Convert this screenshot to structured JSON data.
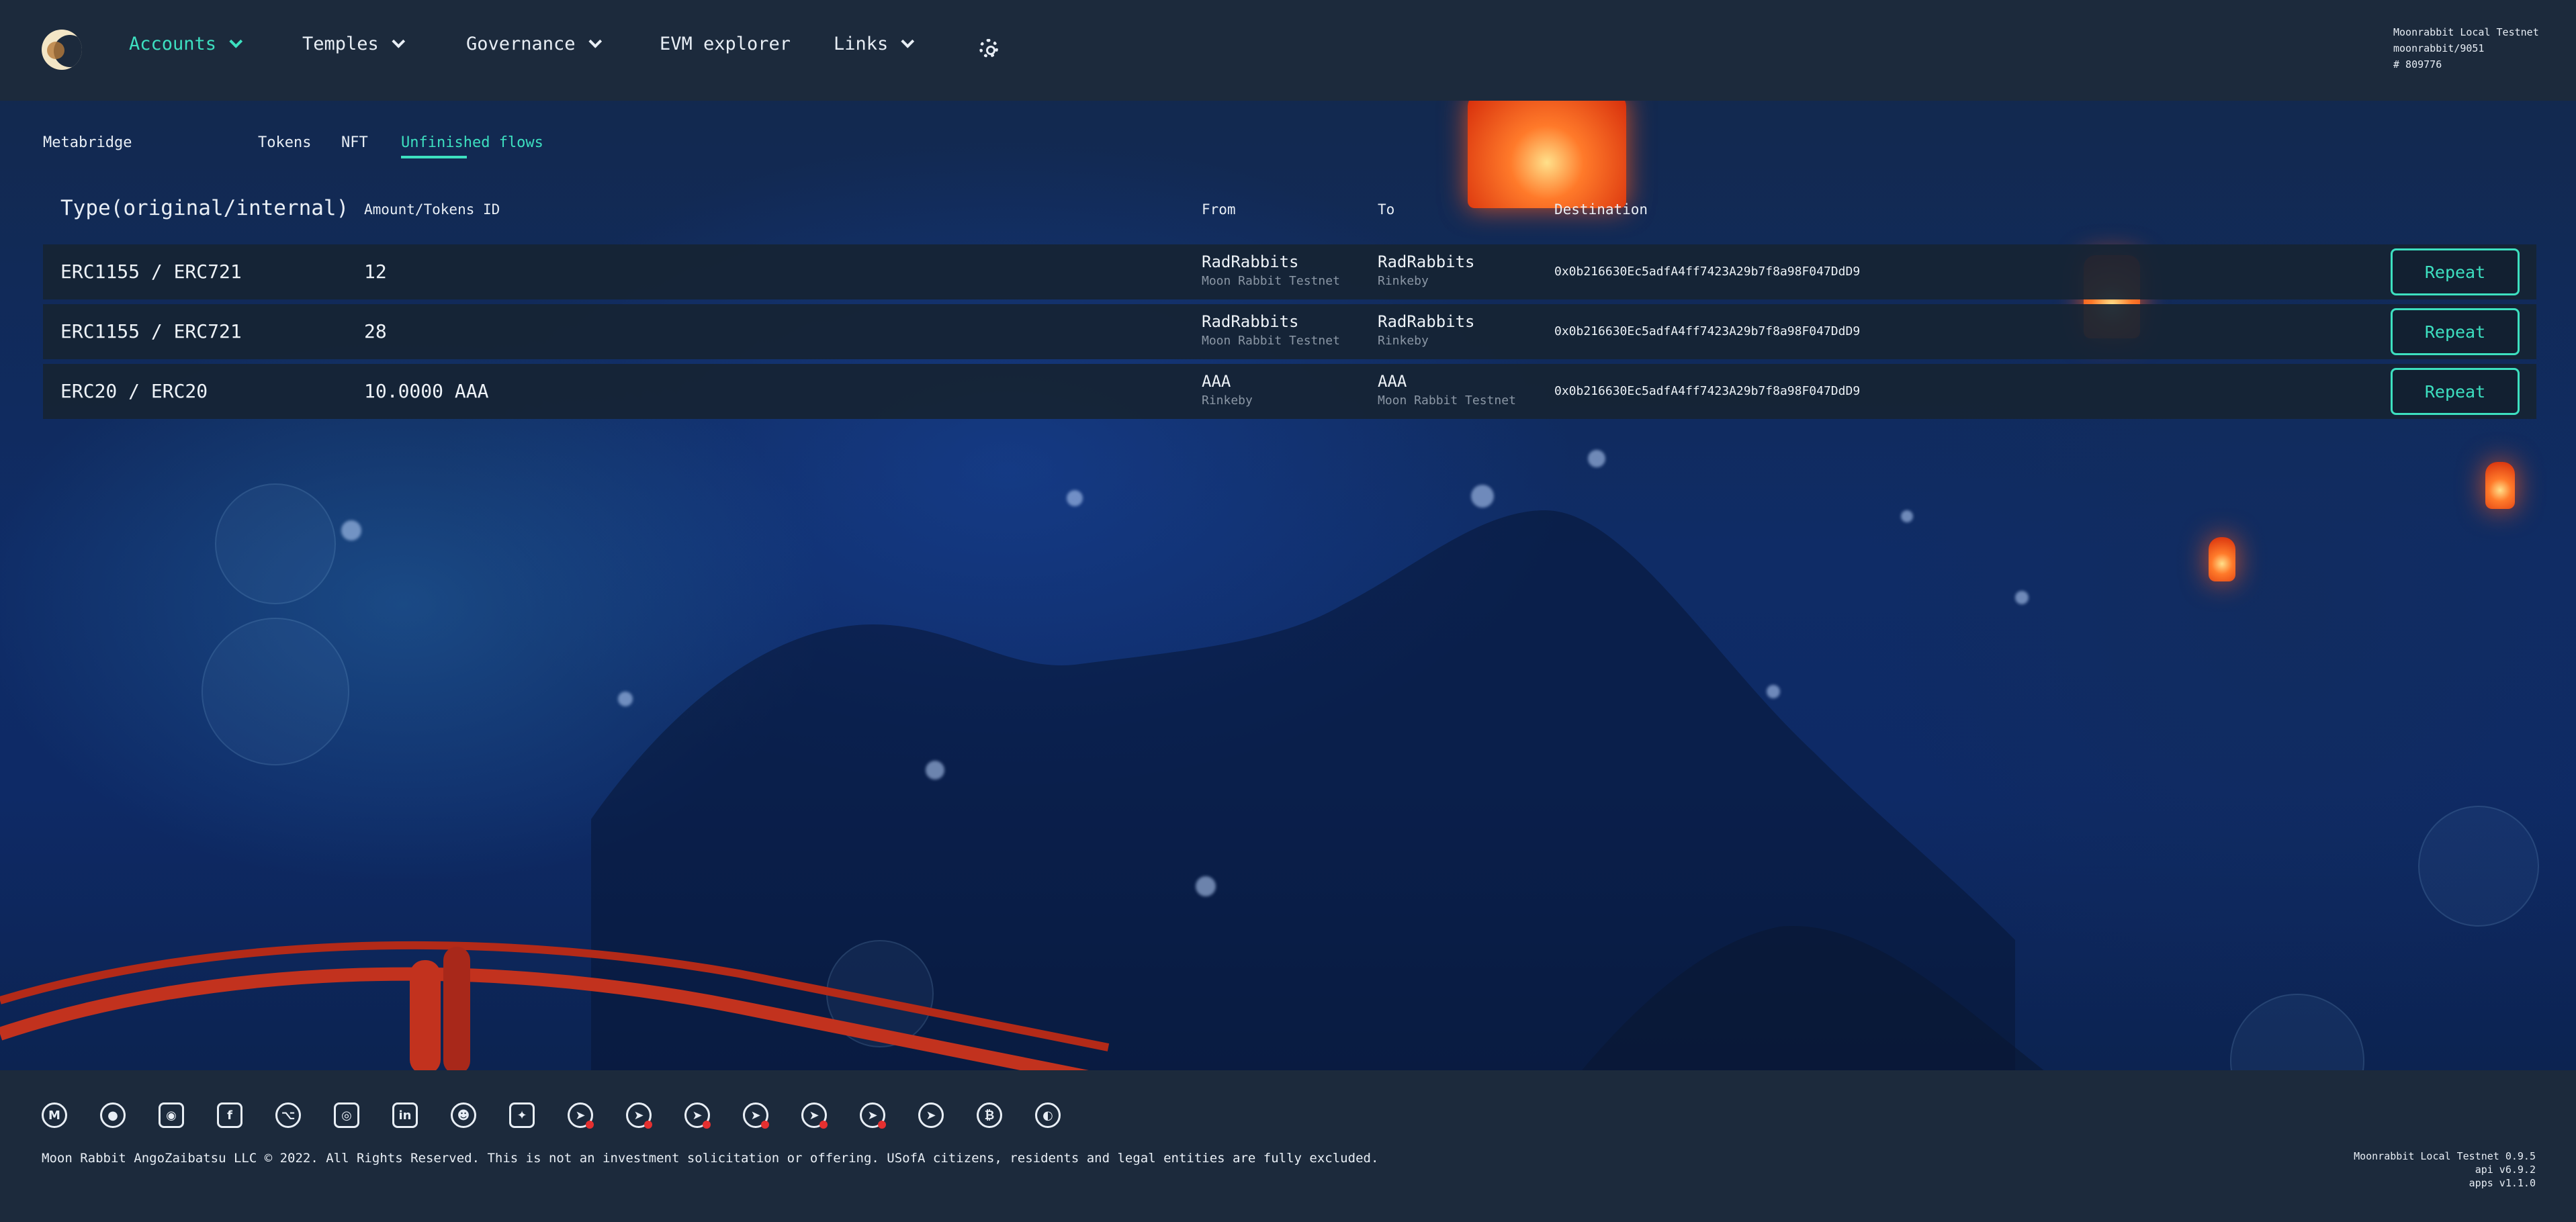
{
  "colors": {
    "accent": "#3de0c0",
    "topbar_bg": "#1c2a3c",
    "row_bg": "#162434"
  },
  "nav": {
    "items": [
      {
        "label": "Accounts",
        "active": true,
        "has_dropdown": true
      },
      {
        "label": "Temples",
        "has_dropdown": true
      },
      {
        "label": "Governance",
        "has_dropdown": true
      },
      {
        "label": "EVM explorer",
        "has_dropdown": false
      },
      {
        "label": "Links",
        "has_dropdown": true
      }
    ],
    "settings_icon": "gear-icon"
  },
  "network": {
    "name": "Moonrabbit Local Testnet",
    "spec": "moonrabbit/9051",
    "block": "# 809776"
  },
  "subnav": {
    "section": "Metabridge",
    "tabs": [
      "Tokens",
      "NFT",
      "Unfinished flows"
    ],
    "active_tab": "Unfinished flows"
  },
  "table": {
    "headers": {
      "type": "Type(original/internal)",
      "amount": "Amount/Tokens ID",
      "from": "From",
      "to": "To",
      "destination": "Destination"
    },
    "rows": [
      {
        "type": "ERC1155 / ERC721",
        "amount": "12",
        "from_name": "RadRabbits",
        "from_chain": "Moon Rabbit Testnet",
        "to_name": "RadRabbits",
        "to_chain": "Rinkeby",
        "destination": "0x0b216630Ec5adfA4ff7423A29b7f8a98F047DdD9",
        "action": "Repeat"
      },
      {
        "type": "ERC1155 / ERC721",
        "amount": "28",
        "from_name": "RadRabbits",
        "from_chain": "Moon Rabbit Testnet",
        "to_name": "RadRabbits",
        "to_chain": "Rinkeby",
        "destination": "0x0b216630Ec5adfA4ff7423A29b7f8a98F047DdD9",
        "action": "Repeat"
      },
      {
        "type": "ERC20 / ERC20",
        "amount": "10.0000 AAA",
        "from_name": "AAA",
        "from_chain": "Rinkeby",
        "to_name": "AAA",
        "to_chain": "Moon Rabbit Testnet",
        "destination": "0x0b216630Ec5adfA4ff7423A29b7f8a98F047DdD9",
        "action": "Repeat"
      }
    ]
  },
  "footer": {
    "social_icons": [
      "medium-icon",
      "coingecko-icon",
      "discord-icon",
      "facebook-icon",
      "github-icon",
      "instagram-icon",
      "linkedin-icon",
      "reddit-icon",
      "twitter-icon",
      "telegram-icon",
      "telegram-icon",
      "telegram-icon",
      "telegram-icon",
      "telegram-icon",
      "telegram-icon",
      "telegram-icon",
      "bitcoin-icon",
      "weibo-icon"
    ],
    "copyright": "Moon Rabbit AngoZaibatsu LLC © 2022. All Rights Reserved. This is not an investment solicitation or offering. USofA citizens, residents and legal entities are fully excluded.",
    "version_lines": [
      "Moonrabbit Local Testnet 0.9.5",
      "api v6.9.2",
      "apps v1.1.0"
    ]
  }
}
